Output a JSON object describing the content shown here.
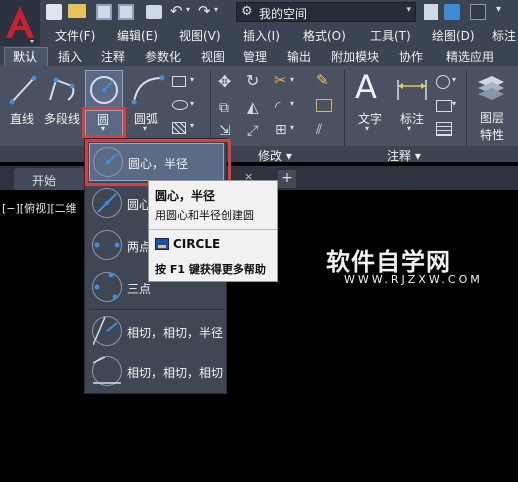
{
  "title_bar": {
    "workspace": "我的空间"
  },
  "menu_bar": {
    "items": [
      "文件(F)",
      "编辑(E)",
      "视图(V)",
      "插入(I)",
      "格式(O)",
      "工具(T)",
      "绘图(D)",
      "标注"
    ]
  },
  "ribbon_tabs": [
    "默认",
    "插入",
    "注释",
    "参数化",
    "视图",
    "管理",
    "输出",
    "附加模块",
    "协作",
    "精选应用"
  ],
  "ribbon": {
    "draw_tools": [
      "直线",
      "多段线",
      "圆",
      "圆弧"
    ],
    "modify_panel": "修改 ▾",
    "annotation_panel": "注释 ▾",
    "annotation_tools": [
      "文字",
      "标注"
    ],
    "layer_tool": [
      "图层",
      "特性"
    ]
  },
  "file_tabs": {
    "start": "开始"
  },
  "viewport_label": "[−][俯视][二维",
  "circle_dropdown": {
    "items": [
      "圆心，半径",
      "圆心",
      "两点",
      "三点",
      "相切，相切，半径",
      "相切，相切，相切"
    ]
  },
  "tooltip": {
    "title": "圆心，半径",
    "description": "用圆心和半径创建圆",
    "command": "CIRCLE",
    "help": "按 F1 键获得更多帮助"
  },
  "watermark": {
    "main": "软件自学网",
    "sub": "WWW.RJZXW.COM"
  },
  "colors": {
    "highlight": "#e23b3b",
    "accent": "#2e6fd8",
    "logo": "#c8202e"
  }
}
